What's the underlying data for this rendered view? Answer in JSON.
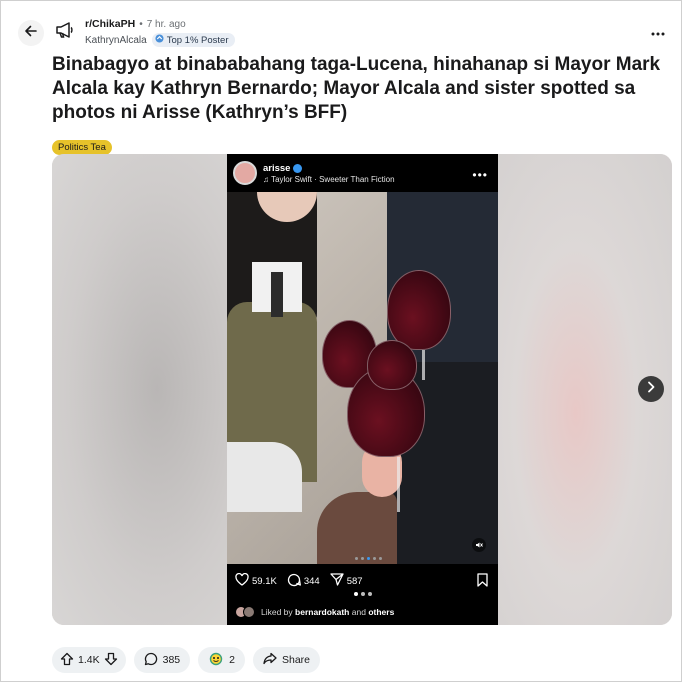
{
  "header": {
    "subreddit": "r/ChikaPH",
    "separator": "•",
    "time": "7 hr. ago",
    "username": "KathrynAlcala",
    "user_flair": "Top 1% Poster"
  },
  "post": {
    "title": "Binabagyo at binababahang taga-Lucena, hinahanap si Mayor Mark Alcala kay Kathryn Bernardo; Mayor Alcala and sister spotted sa photos ni Arisse (Kathryn’s BFF)",
    "flair": "Politics Tea"
  },
  "instagram": {
    "username": "arisse",
    "song": "Taylor Swift · Sweeter Than Fiction",
    "likes": "59.1K",
    "comments": "344",
    "shares": "587",
    "liked_by_prefix": "Liked by",
    "liked_by_user": "bernardokath",
    "liked_by_and": "and",
    "liked_by_others": "others"
  },
  "footer": {
    "votes": "1.4K",
    "comments": "385",
    "awards": "2",
    "share_label": "Share"
  },
  "colors": {
    "flair_bg": "#e6c22a",
    "accent": "#3897f0"
  }
}
